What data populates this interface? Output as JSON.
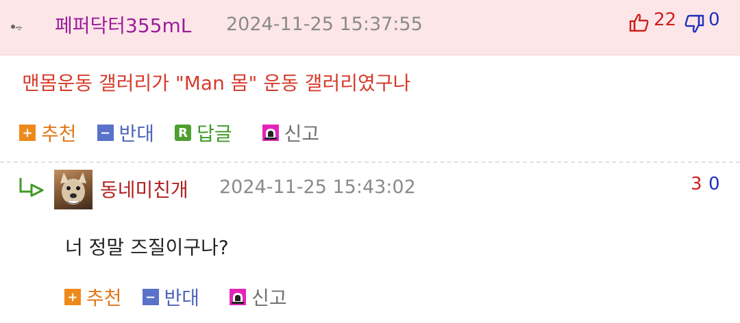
{
  "comment1": {
    "nickname": "페퍼닥터355mL",
    "timestamp": "2024-11-25 15:37:55",
    "upvotes": "22",
    "downvotes": "0",
    "text": "맨몸운동 갤러리가 \"Man 몸\" 운동 갤러리였구나",
    "actions": {
      "recommend": "추천",
      "oppose": "반대",
      "reply": "답글",
      "report": "신고"
    }
  },
  "reply1": {
    "nickname": "동네미친개",
    "timestamp": "2024-11-25 15:43:02",
    "upvotes": "3",
    "downvotes": "0",
    "text": "너 정말 즈질이구나?",
    "actions": {
      "recommend": "추천",
      "oppose": "반대",
      "report": "신고"
    }
  },
  "badges": {
    "plus": "+",
    "minus": "−",
    "reply": "R"
  },
  "icons": {
    "upvote": "thumbs-up-icon",
    "downvote": "thumbs-down-icon",
    "report": "siren-icon",
    "reply_indicator": "reply-arrow-icon",
    "user_level": "small-level-icon"
  },
  "colors": {
    "header_bg": "#fde6e8",
    "nick1": "#9a1d9a",
    "nick2": "#b02020",
    "comment1_text": "#d63a2a",
    "upvote": "#cc1f1f",
    "downvote": "#1f2fbf"
  }
}
